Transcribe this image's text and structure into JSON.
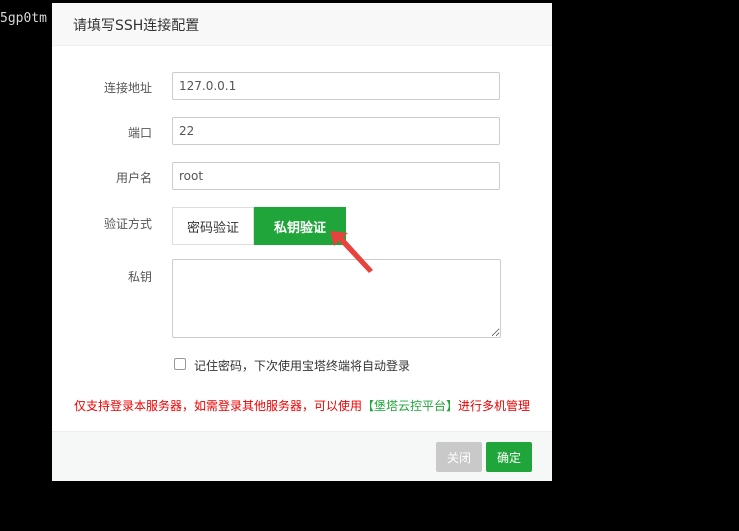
{
  "terminal": {
    "text": "5gp0tm"
  },
  "dialog": {
    "title": "请填写SSH连接配置"
  },
  "form": {
    "host": {
      "label": "连接地址",
      "value": "127.0.0.1"
    },
    "port": {
      "label": "端口",
      "value": "22"
    },
    "username": {
      "label": "用户名",
      "value": "root"
    },
    "auth": {
      "label": "验证方式",
      "password_option": "密码验证",
      "key_option": "私钥验证",
      "selected": "私钥验证"
    },
    "private_key": {
      "label": "私钥",
      "value": ""
    },
    "remember": {
      "checked": false,
      "label": "记住密码，下次使用宝塔终端将自动登录"
    }
  },
  "notice": {
    "text_before": "仅支持登录本服务器，如需登录其他服务器，可以使用",
    "link_text": "【堡塔云控平台】",
    "text_after": "进行多机管理"
  },
  "footer": {
    "close_label": "关闭",
    "confirm_label": "确定"
  },
  "colors": {
    "accent": "#20a53a",
    "notice": "#ee0000",
    "disabled_button": "#c9c9c9",
    "arrow": "#e8423f"
  },
  "icons": {
    "pointer": "red-arrow-icon"
  }
}
